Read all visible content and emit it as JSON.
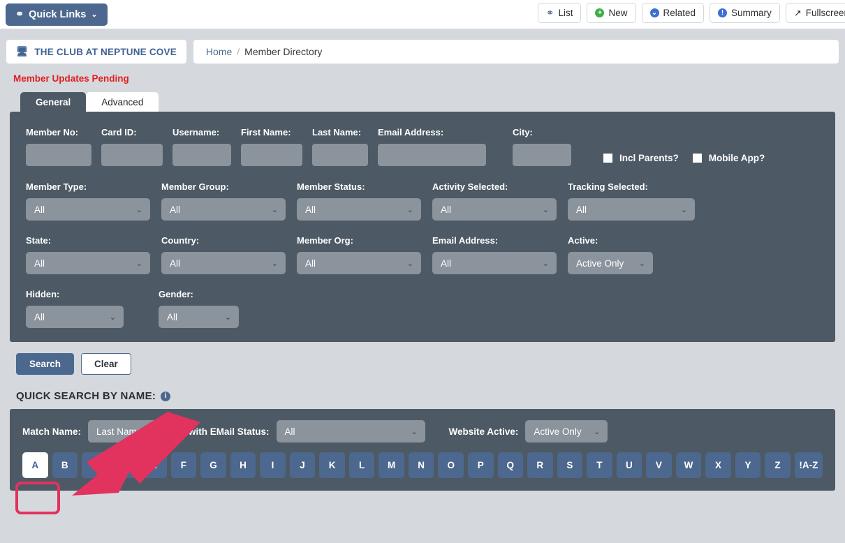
{
  "toolbar": {
    "quick_links": "Quick Links",
    "quick_links_icon": "link-icon",
    "quick_links_chevron": "⌄",
    "buttons": [
      {
        "label": "List",
        "icon": "link-icon",
        "glyph": "⚭"
      },
      {
        "label": "New",
        "icon": "plus-circle-icon",
        "glyph": "+"
      },
      {
        "label": "Related",
        "icon": "chevron-circle-down-icon",
        "glyph": "⌄"
      },
      {
        "label": "Summary",
        "icon": "info-circle-icon",
        "glyph": "!"
      },
      {
        "label": "Fullscreen",
        "icon": "expand-arrows-icon",
        "glyph": "⤢"
      }
    ]
  },
  "header": {
    "club_name": "THE CLUB AT NEPTUNE COVE",
    "club_icon": "monitor-icon",
    "breadcrumb_home": "Home",
    "breadcrumb_sep": "/",
    "breadcrumb_current": "Member Directory",
    "alert": "Member Updates Pending"
  },
  "tabs": [
    {
      "label": "General",
      "active": true
    },
    {
      "label": "Advanced",
      "active": false
    }
  ],
  "search_form": {
    "text_fields": [
      {
        "label": "Member No:",
        "value": "",
        "width": 94
      },
      {
        "label": "Card ID:",
        "value": "",
        "width": 88
      },
      {
        "label": "Username:",
        "value": "",
        "width": 84
      },
      {
        "label": "First Name:",
        "value": "",
        "width": 88
      },
      {
        "label": "Last Name:",
        "value": "",
        "width": 80
      },
      {
        "label": "Email Address:",
        "value": "",
        "width": 155
      },
      {
        "label": "City:",
        "value": "",
        "width": 84
      }
    ],
    "checkboxes": [
      {
        "label": "Incl Parents?",
        "checked": false
      },
      {
        "label": "Mobile App?",
        "checked": false
      }
    ],
    "selects_row1": [
      {
        "label": "Member Type:",
        "value": "All",
        "width": 178
      },
      {
        "label": "Member Group:",
        "value": "All",
        "width": 178
      },
      {
        "label": "Member Status:",
        "value": "All",
        "width": 178
      },
      {
        "label": "Activity Selected:",
        "value": "All",
        "width": 178
      },
      {
        "label": "Tracking Selected:",
        "value": "All",
        "width": 182
      }
    ],
    "selects_row2": [
      {
        "label": "State:",
        "value": "All",
        "width": 178
      },
      {
        "label": "Country:",
        "value": "All",
        "width": 178
      },
      {
        "label": "Member Org:",
        "value": "All",
        "width": 178
      },
      {
        "label": "Email Address:",
        "value": "All",
        "width": 178
      },
      {
        "label": "Active:",
        "value": "Active Only",
        "width": 122
      }
    ],
    "selects_row3": [
      {
        "label": "Hidden:",
        "value": "All",
        "width": 140
      },
      {
        "label": "Gender:",
        "value": "All",
        "width": 115
      }
    ]
  },
  "actions": {
    "search_label": "Search",
    "clear_label": "Clear"
  },
  "quick_search": {
    "title": "QUICK SEARCH BY NAME:",
    "info_icon": "info-icon",
    "info_glyph": "i",
    "match_label": "Match Name:",
    "match_value": "Last Name",
    "email_status_label": "with EMail Status:",
    "email_status_value": "All",
    "website_active_label": "Website Active:",
    "website_active_value": "Active Only",
    "letters": [
      "A",
      "B",
      "C",
      "D",
      "E",
      "F",
      "G",
      "H",
      "I",
      "J",
      "K",
      "L",
      "M",
      "N",
      "O",
      "P",
      "Q",
      "R",
      "S",
      "T",
      "U",
      "V",
      "W",
      "X",
      "Y",
      "Z",
      "!A-Z"
    ],
    "selected_letter": "A"
  },
  "annotation": {
    "arrow_color": "#e2325e",
    "highlight_color": "#e2325e",
    "target": "A"
  },
  "colors": {
    "panel_dark": "#4d5964",
    "field_grey": "#8b939c",
    "accent_blue": "#4c688e",
    "page_bg": "#d5d9dd",
    "alert_red": "#e02020"
  }
}
